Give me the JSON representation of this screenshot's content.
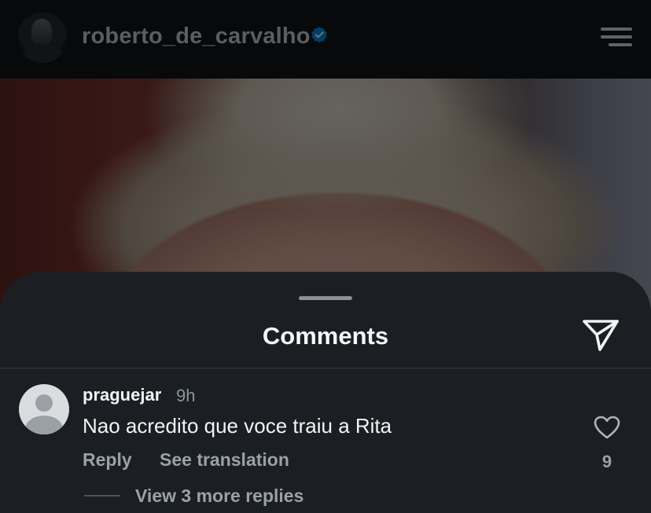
{
  "header": {
    "username": "roberto_de_carvalho",
    "verified_color": "#0095f6",
    "avatar_icon": "profile-photo",
    "menu_icon": "hamburger-menu-icon"
  },
  "post": {
    "image_icon": "post-photo"
  },
  "comments_sheet": {
    "title": "Comments",
    "send_icon": "paper-plane-icon",
    "comments": [
      {
        "username": "praguejar",
        "time": "9h",
        "text": "Nao acredito que voce traiu a Rita",
        "reply_label": "Reply",
        "translate_label": "See translation",
        "likes": "9",
        "view_replies_label": "View 3 more replies"
      }
    ]
  },
  "colors": {
    "sheet_background": "#1b1f23",
    "primary_text": "#f2f3f4",
    "secondary_text": "#9aa1a7"
  }
}
